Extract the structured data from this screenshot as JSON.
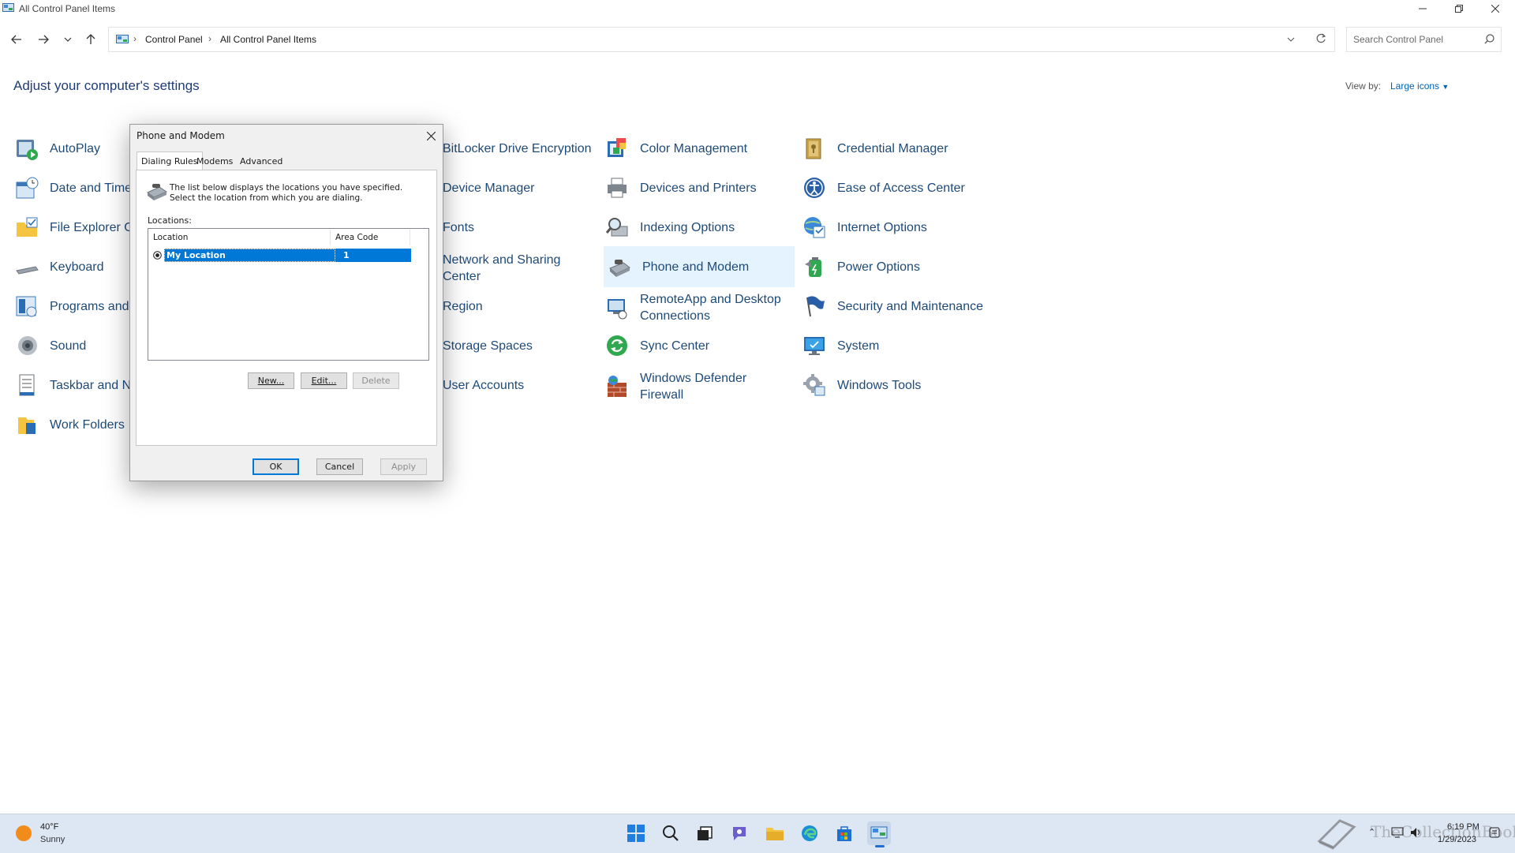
{
  "window": {
    "title": "All Control Panel Items",
    "controls": [
      "minimize",
      "restore",
      "close"
    ]
  },
  "address_bar": {
    "breadcrumbs": [
      "Control Panel",
      "All Control Panel Items"
    ],
    "search_placeholder": "Search Control Panel"
  },
  "header": {
    "heading": "Adjust your computer's settings",
    "view_by_label": "View by:",
    "view_by_value": "Large icons"
  },
  "items": {
    "autoplay": "AutoPlay",
    "date_time": "Date and Time",
    "file_explorer": "File Explorer O",
    "keyboard": "Keyboard",
    "programs": "Programs and",
    "sound": "Sound",
    "taskbar": "Taskbar and Na",
    "work_folders": "Work Folders",
    "bitlocker": "BitLocker Drive Encryption",
    "device_manager": "Device Manager",
    "fonts": "Fonts",
    "network_line1": "Network and Sharing",
    "network_line2": "Center",
    "region": "Region",
    "storage": "Storage Spaces",
    "user_accounts": "User Accounts",
    "color_mgmt": "Color Management",
    "devices_printers": "Devices and Printers",
    "indexing": "Indexing Options",
    "phone_modem": "Phone and Modem",
    "remoteapp_line1": "RemoteApp and Desktop",
    "remoteapp_line2": "Connections",
    "sync": "Sync Center",
    "defender_line1": "Windows Defender",
    "defender_line2": "Firewall",
    "credential": "Credential Manager",
    "ease": "Ease of Access Center",
    "internet": "Internet Options",
    "power": "Power Options",
    "security": "Security and Maintenance",
    "system": "System",
    "tools": "Windows Tools"
  },
  "dialog": {
    "title": "Phone and Modem",
    "tabs": [
      "Dialing Rules",
      "Modems",
      "Advanced"
    ],
    "description": "The list below displays the locations you have specified. Select the location from which you are dialing.",
    "locations_label": "Locations:",
    "columns": [
      "Location",
      "Area Code"
    ],
    "rows": [
      {
        "location": "My Location",
        "area_code": "1"
      }
    ],
    "buttons": {
      "new": "New...",
      "edit": "Edit...",
      "delete": "Delete",
      "ok": "OK",
      "cancel": "Cancel",
      "apply": "Apply"
    }
  },
  "taskbar": {
    "temperature": "40°F",
    "condition": "Sunny",
    "time": "6:19 PM",
    "date": "1/29/2023",
    "watermark": "TheCollectionBook"
  }
}
